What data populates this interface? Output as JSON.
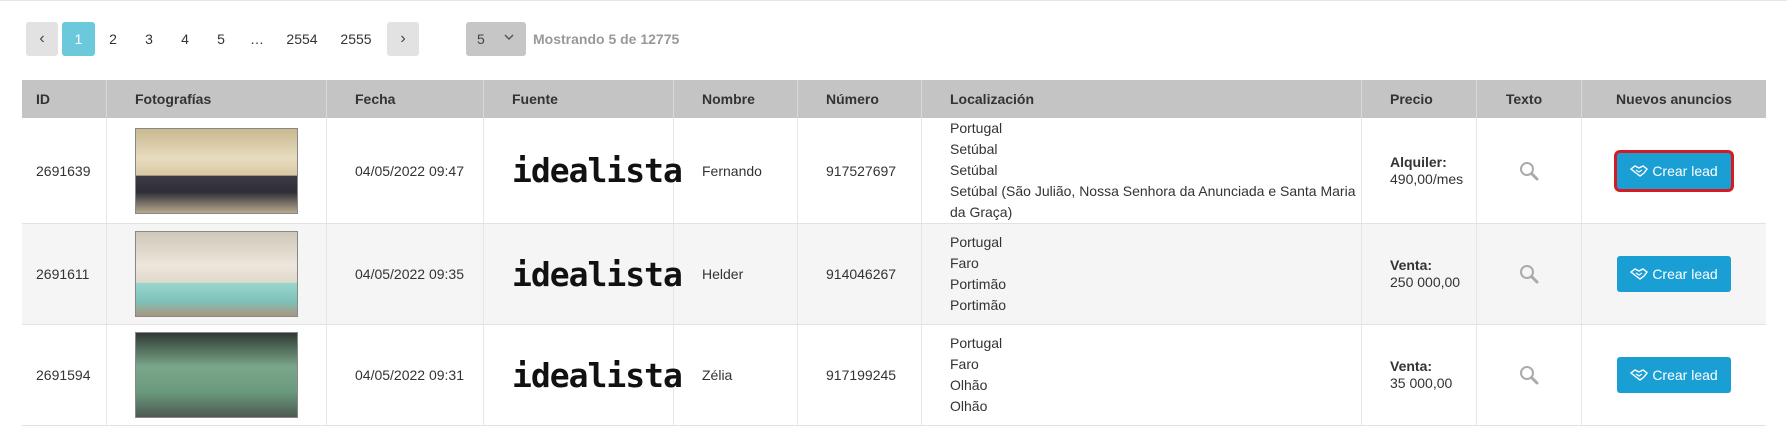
{
  "pagination": {
    "prev": "‹",
    "pages": [
      "1",
      "2",
      "3",
      "4",
      "5",
      "…",
      "2554",
      "2555"
    ],
    "next": "›",
    "page_size": "5",
    "showing": "Mostrando 5 de 12775"
  },
  "table": {
    "headers": {
      "id": "ID",
      "fotos": "Fotografías",
      "fecha": "Fecha",
      "fuente": "Fuente",
      "nombre": "Nombre",
      "numero": "Número",
      "localizacion": "Localización",
      "precio": "Precio",
      "texto": "Texto",
      "nuevos": "Nuevos anuncios"
    },
    "rows": [
      {
        "id": "2691639",
        "fecha": "04/05/2022 09:47",
        "fuente": "idealista",
        "nombre": "Fernando",
        "numero": "917527697",
        "loc": [
          "Portugal",
          "Setúbal",
          "Setúbal",
          "Setúbal (São Julião, Nossa Senhora da Anunciada e Santa Maria",
          "da Graça)"
        ],
        "precio_tipo": "Alquiler:",
        "precio_valor": "490,00/mes",
        "boton": "Crear lead"
      },
      {
        "id": "2691611",
        "fecha": "04/05/2022 09:35",
        "fuente": "idealista",
        "nombre": "Helder",
        "numero": "914046267",
        "loc": [
          "Portugal",
          "Faro",
          "Portimão",
          "Portimão"
        ],
        "precio_tipo": "Venta:",
        "precio_valor": "250 000,00",
        "boton": "Crear lead"
      },
      {
        "id": "2691594",
        "fecha": "04/05/2022 09:31",
        "fuente": "idealista",
        "nombre": "Zélia",
        "numero": "917199245",
        "loc": [
          "Portugal",
          "Faro",
          "Olhão",
          "Olhão"
        ],
        "precio_tipo": "Venta:",
        "precio_valor": "35 000,00",
        "boton": "Crear lead"
      }
    ]
  },
  "icons": {
    "magnifier": "magnifier-icon",
    "handshake": "handshake-icon",
    "chevron": "chevron-down-icon"
  },
  "colors": {
    "active_page": "#6cc9dc",
    "lead_button": "#1a9fd5",
    "highlight_border": "#d71920",
    "header_bg": "#c4c4c4"
  }
}
